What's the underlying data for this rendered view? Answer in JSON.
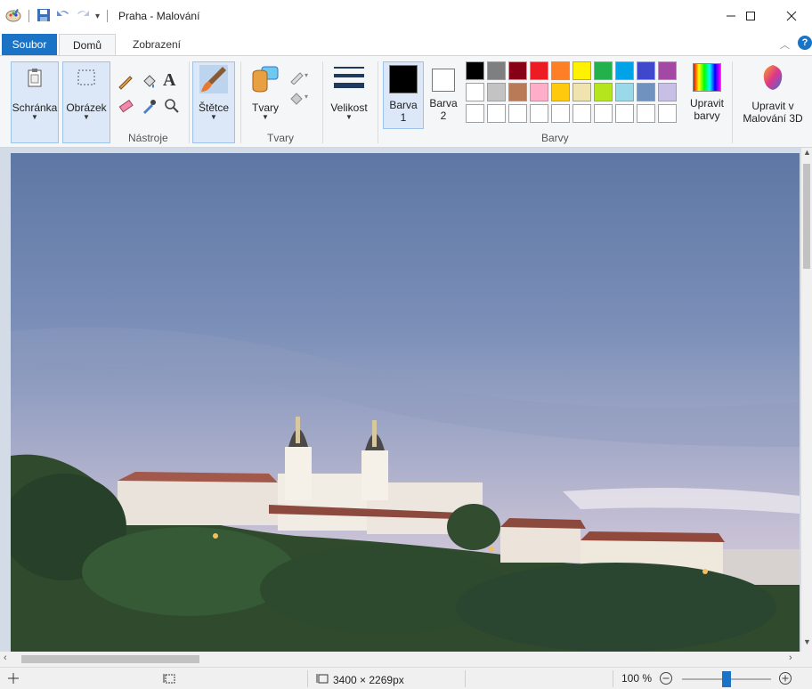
{
  "window": {
    "title": "Praha - Malování"
  },
  "tabs": {
    "file": "Soubor",
    "home": "Domů",
    "view": "Zobrazení"
  },
  "ribbon": {
    "clipboard": "Schránka",
    "image": "Obrázek",
    "tools_group": "Nástroje",
    "brushes": "Štětce",
    "shapes": "Tvary",
    "shapes_group": "Tvary",
    "size": "Velikost",
    "color1_line1": "Barva",
    "color1_line2": "1",
    "color2_line1": "Barva",
    "color2_line2": "2",
    "edit_colors_line1": "Upravit",
    "edit_colors_line2": "barvy",
    "colors_group": "Barvy",
    "paint3d_line1": "Upravit v",
    "paint3d_line2": "Malování 3D"
  },
  "palette": {
    "row1": [
      "#000000",
      "#7f7f7f",
      "#880015",
      "#ed1c24",
      "#ff7f27",
      "#fff200",
      "#22b14c",
      "#00a2e8",
      "#3f48cc",
      "#a349a4"
    ],
    "row2": [
      "#ffffff",
      "#c3c3c3",
      "#b97a57",
      "#ffaec9",
      "#ffc90e",
      "#efe4b0",
      "#b5e61d",
      "#99d9ea",
      "#7092be",
      "#c8bfe7"
    ],
    "row3": [
      "#ffffff",
      "#ffffff",
      "#ffffff",
      "#ffffff",
      "#ffffff",
      "#ffffff",
      "#ffffff",
      "#ffffff",
      "#ffffff",
      "#ffffff"
    ],
    "color1": "#000000",
    "color2": "#ffffff"
  },
  "statusbar": {
    "image_size": "3400 × 2269px",
    "zoom": "100 %",
    "zoom_fraction": 0.5
  }
}
